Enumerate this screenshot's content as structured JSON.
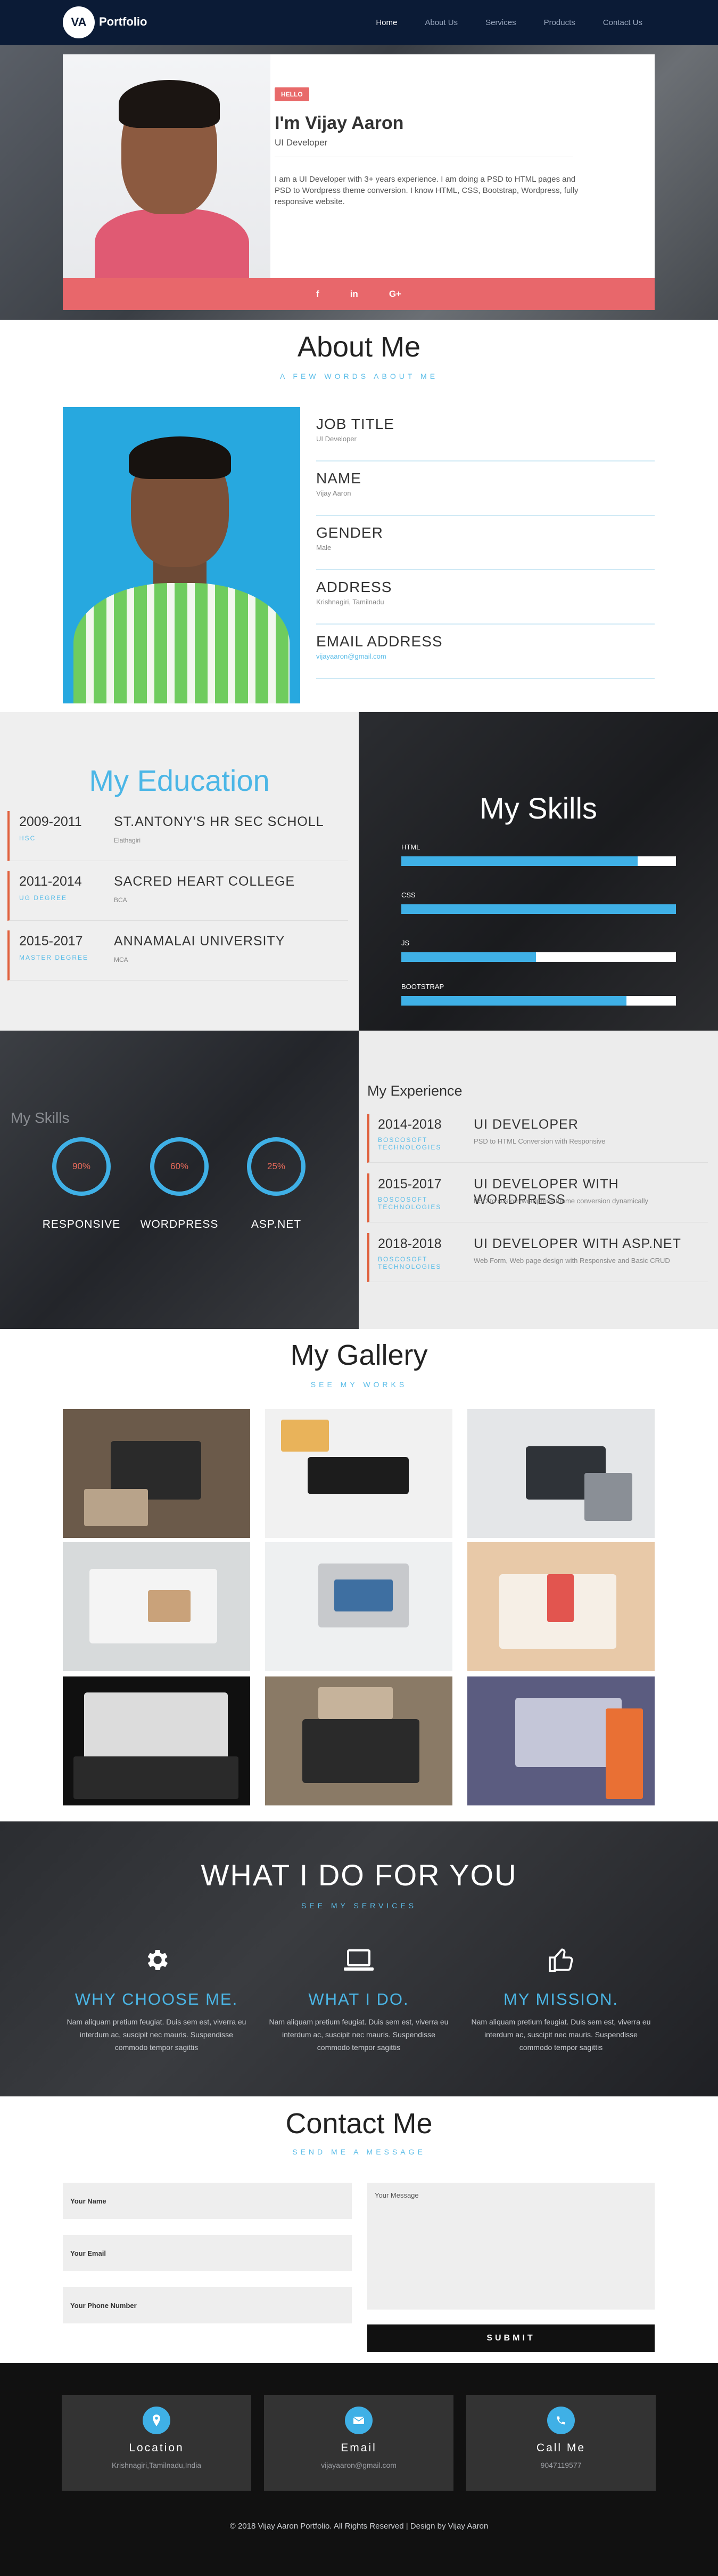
{
  "nav": {
    "logo_initials": "VA",
    "logo_text": "Portfolio",
    "links": [
      "Home",
      "About Us",
      "Services",
      "Products",
      "Contact Us"
    ],
    "active_index": 0
  },
  "hero": {
    "badge": "HELLO",
    "name": "I'm Vijay Aaron",
    "role": "UI Developer",
    "description": "I am a UI Developer with 3+ years experience. I am doing a PSD to HTML pages and PSD to Wordpress theme conversion. I know HTML, CSS, Bootstrap, Wordpress, fully responsive website.",
    "social": [
      "f",
      "in",
      "G+"
    ]
  },
  "about": {
    "title": "About Me",
    "subtitle": "A FEW WORDS ABOUT ME",
    "items": [
      {
        "label": "JOB TITLE",
        "value": "UI Developer"
      },
      {
        "label": "NAME",
        "value": "Vijay Aaron"
      },
      {
        "label": "GENDER",
        "value": "Male"
      },
      {
        "label": "ADDRESS",
        "value": "Krishnagiri, Tamilnadu"
      },
      {
        "label": "EMAIL ADDRESS",
        "value": "vijayaaron@gmail.com"
      }
    ]
  },
  "education": {
    "title": "My Education",
    "rows": [
      {
        "years": "2009-2011",
        "degree": "HSC",
        "school": "ST.ANTONY'S HR SEC SCHOLL",
        "place": "Elathagiri"
      },
      {
        "years": "2011-2014",
        "degree": "UG DEGREE",
        "school": "SACRED HEART COLLEGE",
        "place": "BCA"
      },
      {
        "years": "2015-2017",
        "degree": "MASTER DEGREE",
        "school": "ANNAMALAI UNIVERSITY",
        "place": "MCA"
      }
    ]
  },
  "skills": {
    "title": "My Skills",
    "bars": [
      {
        "name": "HTML",
        "level": 0.86
      },
      {
        "name": "CSS",
        "level": 1.0
      },
      {
        "name": "JS",
        "level": 0.49
      },
      {
        "name": "BOOTSTRAP",
        "level": 0.82
      }
    ]
  },
  "circle_skills": {
    "faded_title": "My Skills",
    "items": [
      {
        "pct": "90%",
        "name": "RESPONSIVE"
      },
      {
        "pct": "60%",
        "name": "WORDPRESS"
      },
      {
        "pct": "25%",
        "name": "ASP.NET"
      }
    ]
  },
  "experience": {
    "title": "My Experience",
    "rows": [
      {
        "years": "2014-2018",
        "company": "BOSCOSOFT TECHNOLOGIES",
        "role": "UI DEVELOPER",
        "desc": "PSD to HTML Conversion with Responsive"
      },
      {
        "years": "2015-2017",
        "company": "BOSCOSOFT TECHNOLOGIES",
        "role": "UI DEVELOPER WITH WORDPRESS",
        "desc": "PSD to custom wordpress theme conversion dynamically"
      },
      {
        "years": "2018-2018",
        "company": "BOSCOSOFT TECHNOLOGIES",
        "role": "UI DEVELOPER WITH ASP.NET",
        "desc": "Web Form, Web page design with Responsive and Basic CRUD"
      }
    ]
  },
  "gallery": {
    "title": "My Gallery",
    "subtitle": "SEE MY WORKS",
    "tiles": [
      {
        "bg": "#6b5a4a",
        "a": "#2a2a2a",
        "b": "#b8a38a"
      },
      {
        "bg": "#f1f1f1",
        "a": "#1c1c1c",
        "b": "#e9b35a"
      },
      {
        "bg": "#e4e6e8",
        "a": "#2f3338",
        "b": "#8a8f96"
      },
      {
        "bg": "#d7dadb",
        "a": "#f4f4f4",
        "b": "#c9a27a"
      },
      {
        "bg": "#eef0f1",
        "a": "#c7c9cc",
        "b": "#3e6fa1"
      },
      {
        "bg": "#e8c9a8",
        "a": "#f6efe6",
        "b": "#e2554f"
      },
      {
        "bg": "#101010",
        "a": "#dcdcdc",
        "b": "#2a2a2a"
      },
      {
        "bg": "#8a7a66",
        "a": "#2a2a2a",
        "b": "#c6b39b"
      },
      {
        "bg": "#5b5c80",
        "a": "#c4c6d8",
        "b": "#e97034"
      }
    ]
  },
  "services": {
    "title": "WHAT I DO FOR YOU",
    "subtitle": "SEE MY SERVICES",
    "items": [
      {
        "icon": "gear-icon",
        "title": "WHY CHOOSE ME.",
        "text": "Nam aliquam pretium feugiat. Duis sem est, viverra eu interdum ac, suscipit nec mauris. Suspendisse commodo tempor sagittis"
      },
      {
        "icon": "laptop-icon",
        "title": "WHAT I DO.",
        "text": "Nam aliquam pretium feugiat. Duis sem est, viverra eu interdum ac, suscipit nec mauris. Suspendisse commodo tempor sagittis"
      },
      {
        "icon": "thumbs-up-icon",
        "title": "MY MISSION.",
        "text": "Nam aliquam pretium feugiat. Duis sem est, viverra eu interdum ac, suscipit nec mauris. Suspendisse commodo tempor sagittis"
      }
    ]
  },
  "contact": {
    "title": "Contact Me",
    "subtitle": "SEND ME A MESSAGE",
    "name_placeholder": "Your Name",
    "email_placeholder": "Your Email",
    "phone_placeholder": "Your Phone Number",
    "message_placeholder": "Your Message",
    "submit": "SUBMIT"
  },
  "footer": {
    "cards": [
      {
        "icon": "location-pin-icon",
        "title": "Location",
        "value": "Krishnagiri,Tamilnadu,India"
      },
      {
        "icon": "email-icon",
        "title": "Email",
        "value": "vijayaaron@gmail.com"
      },
      {
        "icon": "phone-icon",
        "title": "Call Me",
        "value": "9047119577"
      }
    ],
    "copyright": "© 2018 Vijay Aaron Portfolio. All Rights Reserved | Design by Vijay Aaron"
  },
  "colors": {
    "nav_bg": "#0b1b36",
    "accent_blue": "#3fb0e6",
    "accent_red": "#e8676b",
    "accent_orange": "#e0603c"
  }
}
